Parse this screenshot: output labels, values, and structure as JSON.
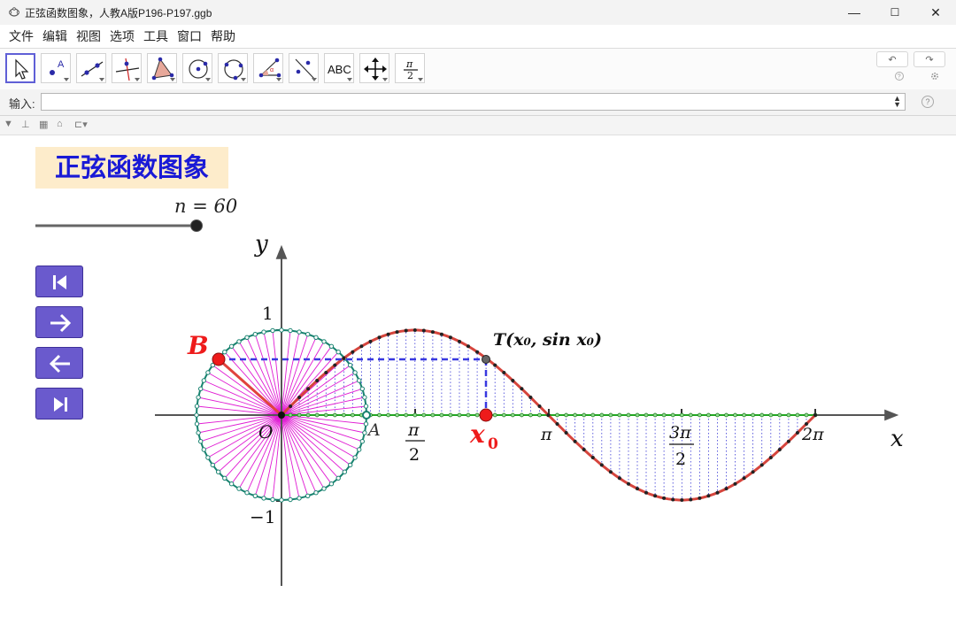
{
  "window": {
    "title": "正弦函数图象，人教A版P196-P197.ggb",
    "minimize": "—",
    "maximize": "☐",
    "close": "✕"
  },
  "menu": [
    "文件",
    "编辑",
    "视图",
    "选项",
    "工具",
    "窗口",
    "帮助"
  ],
  "toolbar": {
    "tools": [
      "move",
      "point",
      "line",
      "perpendicular-line",
      "polygon",
      "circle",
      "circle-through-points",
      "angle",
      "reflect",
      "text",
      "move-graphics-view",
      "slider"
    ],
    "selected": "move",
    "text_tool_label": "ABC",
    "undo": "↶",
    "redo": "↷"
  },
  "input_bar": {
    "label": "输入:",
    "value": ""
  },
  "graphics": {
    "title": "正弦函数图象",
    "slider_label": "n = 60",
    "slider_value": 60,
    "slider_fraction": 1.0,
    "axis_x_label": "x",
    "axis_y_label": "y",
    "origin_label": "O",
    "y_ticks": [
      "1",
      "−1"
    ],
    "x_tick_pi_over_2_num": "π",
    "x_tick_pi_over_2_den": "2",
    "x_tick_pi": "π",
    "x_tick_3pi_over_2_num": "3π",
    "x_tick_3pi_over_2_den": "2",
    "x_tick_2pi": "2π",
    "point_A": "A",
    "point_B": "B",
    "point_x0": "x",
    "point_x0_sub": "0",
    "point_T": "T(x₀, sin x₀)",
    "colors": {
      "curve": "#d6453d",
      "radii": "#e01cd3",
      "circle": "#17826f",
      "projection": "#3838e0",
      "nav_button": "#6a5acd",
      "title_bg": "#fdeccb",
      "title_fg": "#1a1ad6"
    }
  },
  "nav_buttons": [
    "first",
    "next",
    "previous",
    "last"
  ]
}
